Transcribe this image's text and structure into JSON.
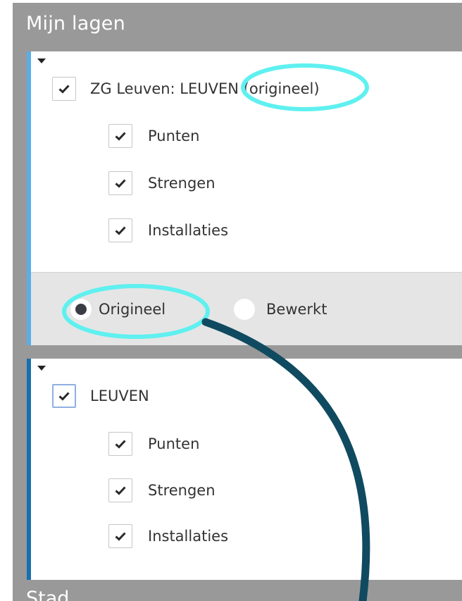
{
  "panel": {
    "title": "Mijn lagen",
    "next_section_title": "Stad",
    "colors": {
      "background": "#999999",
      "accent_light": "#5aaee6",
      "accent_dark": "#1a6fae"
    }
  },
  "layers": [
    {
      "title": "ZG Leuven: LEUVEN (origineel)",
      "checked": true,
      "sublayers": [
        {
          "label": "Punten",
          "checked": true
        },
        {
          "label": "Strengen",
          "checked": true
        },
        {
          "label": "Installaties",
          "checked": true
        }
      ],
      "version_switch": {
        "options": [
          {
            "label": "Origineel",
            "selected": true
          },
          {
            "label": "Bewerkt",
            "selected": false
          }
        ]
      }
    },
    {
      "title": "LEUVEN",
      "checked": true,
      "sublayers": [
        {
          "label": "Punten",
          "checked": true
        },
        {
          "label": "Strengen",
          "checked": true
        },
        {
          "label": "Installaties",
          "checked": true
        }
      ]
    }
  ],
  "annotations": {
    "highlight_color": "#5ff0f0",
    "arrow_color": "#0f4a60",
    "highlights": [
      "(origineel)",
      "Origineel"
    ]
  }
}
